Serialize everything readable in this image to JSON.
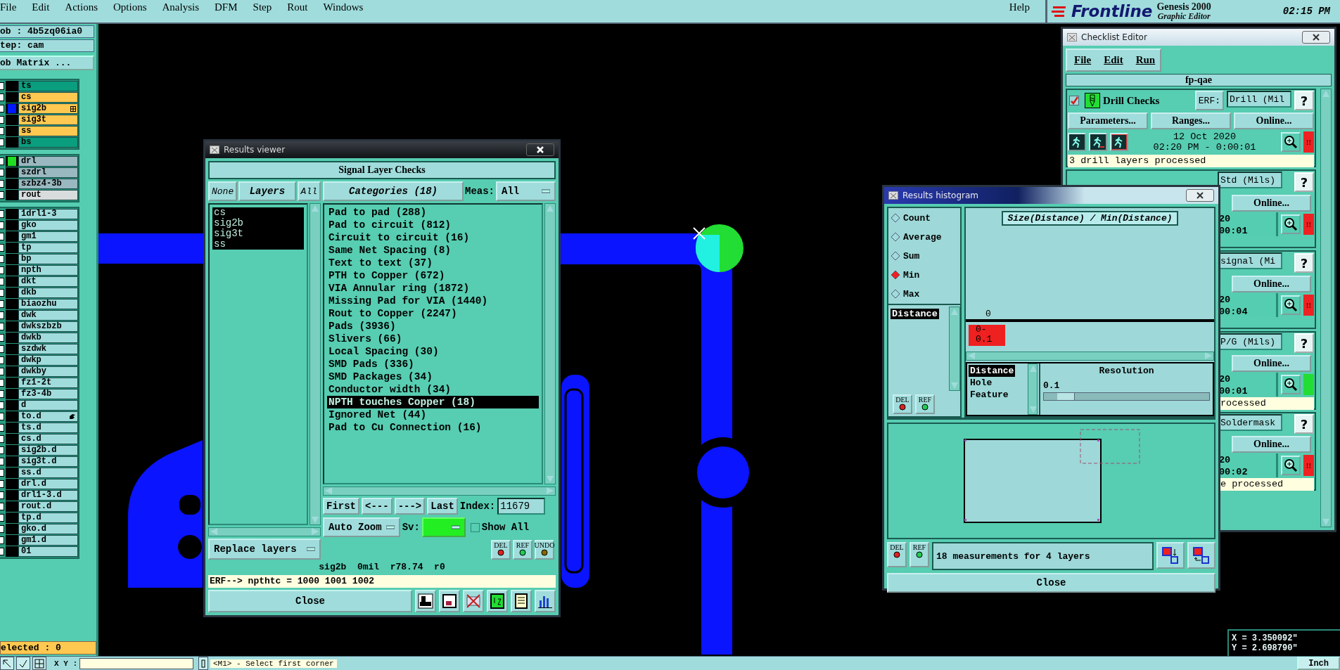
{
  "menu_bar": {
    "items": [
      "File",
      "Edit",
      "Actions",
      "Options",
      "Analysis",
      "DFM",
      "Step",
      "Rout",
      "Windows"
    ],
    "help": "Help"
  },
  "brand": {
    "logo": "Frontline",
    "product": "Genesis 2000",
    "subtitle": "Graphic Editor",
    "time": "02:15 PM"
  },
  "job_panel": {
    "job": "ob : 4b5zq06ia0",
    "step": "tep: cam",
    "matrix_button": "ob Matrix ...",
    "layer_groups": [
      {
        "kind": "board",
        "layers": [
          {
            "name": "ts",
            "color": "#0a9e7e",
            "checked": false,
            "affected": false,
            "kind": "layer"
          },
          {
            "name": "cs",
            "color": "#ffc850",
            "checked": false,
            "affected": false,
            "kind": "layer"
          },
          {
            "name": "sig2b",
            "color": "#ffc850",
            "checked": false,
            "affected": true,
            "kind": "grid"
          },
          {
            "name": "sig3t",
            "color": "#ffc850",
            "checked": false,
            "affected": false,
            "kind": "layer"
          },
          {
            "name": "ss",
            "color": "#ffc850",
            "checked": false,
            "affected": false,
            "kind": "layer"
          },
          {
            "name": "bs",
            "color": "#0a9e7e",
            "checked": false,
            "affected": false,
            "kind": "layer"
          }
        ]
      },
      {
        "kind": "drill",
        "layers": [
          {
            "name": "drl",
            "color": "#9ab8c0",
            "checked": false,
            "affected": true,
            "kind": "layer"
          },
          {
            "name": "szdrl",
            "color": "#9ab8c0",
            "checked": false,
            "affected": false,
            "kind": "layer"
          },
          {
            "name": "szbz4-3b",
            "color": "#9ab8c0",
            "checked": false,
            "affected": false,
            "kind": "layer"
          },
          {
            "name": "rout",
            "color": "#d8dcdc",
            "checked": false,
            "affected": false,
            "kind": "layer"
          }
        ]
      },
      {
        "kind": "misc",
        "layers": [
          {
            "name": "1drl1-3",
            "color": "#a0dcdc",
            "checked": false,
            "affected": false,
            "kind": "layer"
          },
          {
            "name": "gko",
            "color": "#a0dcdc",
            "checked": false,
            "affected": false,
            "kind": "layer"
          },
          {
            "name": "gm1",
            "color": "#a0dcdc",
            "checked": false,
            "affected": false,
            "kind": "layer"
          },
          {
            "name": "tp",
            "color": "#a0dcdc",
            "checked": false,
            "affected": false,
            "kind": "layer"
          },
          {
            "name": "bp",
            "color": "#a0dcdc",
            "checked": false,
            "affected": false,
            "kind": "layer"
          },
          {
            "name": "npth",
            "color": "#a0dcdc",
            "checked": false,
            "affected": false,
            "kind": "layer"
          },
          {
            "name": "dkt",
            "color": "#a0dcdc",
            "checked": false,
            "affected": false,
            "kind": "layer"
          },
          {
            "name": "dkb",
            "color": "#a0dcdc",
            "checked": false,
            "affected": false,
            "kind": "layer"
          },
          {
            "name": "biaozhu",
            "color": "#a0dcdc",
            "checked": false,
            "affected": false,
            "kind": "layer"
          },
          {
            "name": "dwk",
            "color": "#a0dcdc",
            "checked": false,
            "affected": false,
            "kind": "layer"
          },
          {
            "name": "dwkszbzb",
            "color": "#a0dcdc",
            "checked": false,
            "affected": false,
            "kind": "layer"
          },
          {
            "name": "dwkb",
            "color": "#a0dcdc",
            "checked": false,
            "affected": false,
            "kind": "layer"
          },
          {
            "name": "szdwk",
            "color": "#a0dcdc",
            "checked": false,
            "affected": false,
            "kind": "layer"
          },
          {
            "name": "dwkp",
            "color": "#a0dcdc",
            "checked": false,
            "affected": false,
            "kind": "layer"
          },
          {
            "name": "dwkby",
            "color": "#a0dcdc",
            "checked": false,
            "affected": false,
            "kind": "layer"
          },
          {
            "name": "fz1-2t",
            "color": "#a0dcdc",
            "checked": false,
            "affected": false,
            "kind": "layer"
          },
          {
            "name": "fz3-4b",
            "color": "#a0dcdc",
            "checked": false,
            "affected": false,
            "kind": "layer"
          },
          {
            "name": "d",
            "color": "#a0dcdc",
            "checked": false,
            "affected": false,
            "kind": "layer"
          },
          {
            "name": "to.d",
            "color": "#a0dcdc",
            "checked": false,
            "affected": false,
            "kind": "pointer"
          },
          {
            "name": "ts.d",
            "color": "#a0dcdc",
            "checked": false,
            "affected": false,
            "kind": "layer"
          },
          {
            "name": "cs.d",
            "color": "#a0dcdc",
            "checked": false,
            "affected": false,
            "kind": "layer"
          },
          {
            "name": "sig2b.d",
            "color": "#a0dcdc",
            "checked": false,
            "affected": false,
            "kind": "layer"
          },
          {
            "name": "sig3t.d",
            "color": "#a0dcdc",
            "checked": false,
            "affected": false,
            "kind": "layer"
          },
          {
            "name": "ss.d",
            "color": "#a0dcdc",
            "checked": false,
            "affected": false,
            "kind": "layer"
          },
          {
            "name": "drl.d",
            "color": "#a0dcdc",
            "checked": false,
            "affected": false,
            "kind": "layer"
          },
          {
            "name": "drl1-3.d",
            "color": "#a0dcdc",
            "checked": false,
            "affected": false,
            "kind": "layer"
          },
          {
            "name": "rout.d",
            "color": "#a0dcdc",
            "checked": false,
            "affected": false,
            "kind": "layer"
          },
          {
            "name": "tp.d",
            "color": "#a0dcdc",
            "checked": false,
            "affected": false,
            "kind": "layer"
          },
          {
            "name": "gko.d",
            "color": "#a0dcdc",
            "checked": false,
            "affected": false,
            "kind": "layer"
          },
          {
            "name": "gm1.d",
            "color": "#a0dcdc",
            "checked": false,
            "affected": false,
            "kind": "layer"
          },
          {
            "name": "01",
            "color": "#a0dcdc",
            "checked": false,
            "affected": false,
            "kind": "layer"
          }
        ]
      }
    ],
    "selected_count": "elected : 0"
  },
  "canvas": {
    "x_readout": "X = 3.350092\"",
    "y_readout": "Y = 2.698790\""
  },
  "status_bar": {
    "xy_label": "X Y :",
    "message": "<M1> - Select first corner",
    "units": "Inch"
  },
  "results_viewer": {
    "title": "Results viewer",
    "heading": "Signal Layer Checks",
    "layer_buttons": [
      {
        "label": "None",
        "kind": "filter"
      },
      {
        "label": "Layers",
        "kind": "header"
      },
      {
        "label": "All",
        "kind": "filter"
      }
    ],
    "layers": [
      {
        "name": "cs",
        "selected": true
      },
      {
        "name": "sig2b",
        "selected": true
      },
      {
        "name": "sig3t",
        "selected": true
      },
      {
        "name": "ss",
        "selected": true
      }
    ],
    "replace_mode": "Replace layers",
    "categories_button": "Categories (18)",
    "meas_label": "Meas:",
    "meas_value": "All",
    "categories": [
      {
        "label": "Pad to pad (288)",
        "selected": false
      },
      {
        "label": "Pad to circuit (812)",
        "selected": false
      },
      {
        "label": "Circuit to circuit (16)",
        "selected": false
      },
      {
        "label": "Same Net Spacing (8)",
        "selected": false
      },
      {
        "label": "Text to text (37)",
        "selected": false
      },
      {
        "label": "PTH to Copper (672)",
        "selected": false
      },
      {
        "label": "VIA Annular ring (1872)",
        "selected": false
      },
      {
        "label": "Missing Pad for VIA (1440)",
        "selected": false
      },
      {
        "label": "Rout to Copper (2247)",
        "selected": false
      },
      {
        "label": "Pads (3936)",
        "selected": false
      },
      {
        "label": "Slivers (66)",
        "selected": false
      },
      {
        "label": "Local Spacing (30)",
        "selected": false
      },
      {
        "label": "SMD Pads (336)",
        "selected": false
      },
      {
        "label": "SMD Packages (34)",
        "selected": false
      },
      {
        "label": "Conductor width (34)",
        "selected": false
      },
      {
        "label": "NPTH touches Copper (18)",
        "selected": true
      },
      {
        "label": "Ignored Net (44)",
        "selected": false
      },
      {
        "label": "Pad to Cu Connection (16)",
        "selected": false
      }
    ],
    "nav_buttons": [
      "First",
      "<---",
      "--->",
      "Last"
    ],
    "index_label": "Index:",
    "index_value": "11679",
    "zoom_mode": "Auto Zoom",
    "sv_label": "Sv:",
    "show_all": {
      "label": "Show All",
      "checked": false
    },
    "tool_buttons": [
      "DEL",
      "REF",
      "UNDO"
    ],
    "status": "sig2b  0mil  r78.74  r0",
    "erf": "ERF--> npthtc = 1000 1001 1002",
    "close": "Close"
  },
  "histogram": {
    "title": "Results histogram",
    "functions": [
      {
        "label": "Count",
        "selected": false
      },
      {
        "label": "Average",
        "selected": false
      },
      {
        "label": "Sum",
        "selected": false
      },
      {
        "label": "Min",
        "selected": true
      },
      {
        "label": "Max",
        "selected": false
      }
    ],
    "attributes": [
      {
        "label": "Distance",
        "selected": true
      }
    ],
    "chart_title": "Size(Distance) / Min(Distance)",
    "bin_count": "0",
    "bin_range": "0-0.1",
    "measure_types": [
      {
        "label": "Distance",
        "selected": true
      },
      {
        "label": "Hole",
        "selected": false
      },
      {
        "label": "Feature",
        "selected": false
      }
    ],
    "resolution": {
      "label": "Resolution",
      "value": "0.1",
      "level": 0.08
    },
    "attribute_buttons": [
      "DEL",
      "REF"
    ],
    "bottom_buttons": [
      "DEL",
      "REF"
    ],
    "summary": "18 measurements for 4 layers",
    "close": "Close"
  },
  "checklist_editor": {
    "title": "Checklist Editor",
    "menu": [
      "File",
      "Edit",
      "Run"
    ],
    "name": "fp-qae",
    "checks": [
      {
        "kind": "full",
        "name": "Drill Checks",
        "checked": true,
        "erf_label": "ERF:",
        "erf_value": "Drill (Mil",
        "help": "?",
        "buttons": [
          "Parameters...",
          "Ranges...",
          "Online..."
        ],
        "date": "12 Oct 2020",
        "time": "02:20 PM - 0:00:01",
        "passed": false,
        "flag": "!!",
        "message": "3 drill layers processed"
      },
      {
        "kind": "partial",
        "erf_value": "Std (Mils)",
        "help": "?",
        "online": "Online...",
        "date": "20",
        "time": "00:01",
        "passed": false,
        "flag": "!!"
      },
      {
        "kind": "partial",
        "erf_value": "signal (Mi",
        "help": "?",
        "online": "Online...",
        "date": "20",
        "time": "00:04",
        "passed": false,
        "flag": "!!"
      },
      {
        "kind": "partial",
        "erf_value": "P/G (Mils)",
        "help": "?",
        "online": "Online...",
        "date": "20",
        "time": "00:01",
        "passed": true,
        "message": "rocessed"
      },
      {
        "kind": "partial",
        "erf_value": "Soldermask",
        "help": "?",
        "online": "Online...",
        "date": "20",
        "time": "00:02",
        "passed": false,
        "flag": "!!",
        "message": "e processed"
      }
    ]
  }
}
